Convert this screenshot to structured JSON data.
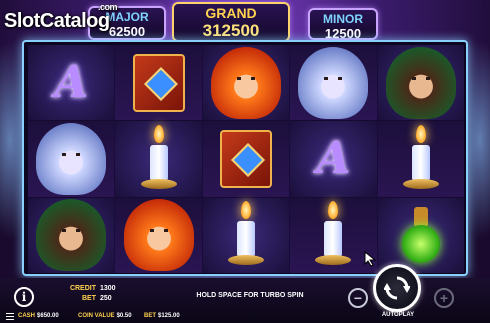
{
  "watermark": {
    "text": "SlotCatalog",
    "suffix": ".com"
  },
  "jackpots": {
    "major": {
      "label": "MAJOR",
      "value": "62500"
    },
    "grand": {
      "label": "GRAND",
      "value": "312500"
    },
    "minor": {
      "label": "MINOR",
      "value": "12500"
    }
  },
  "reels": [
    [
      "letter-a-symbol",
      "ice-witch-symbol",
      "earth-witch-symbol"
    ],
    [
      "spell-book-symbol",
      "candle-symbol",
      "fire-witch-symbol"
    ],
    [
      "fire-witch-symbol",
      "spell-book-symbol",
      "candle-symbol"
    ],
    [
      "ice-witch-symbol",
      "letter-a-symbol",
      "candle-symbol"
    ],
    [
      "earth-witch-symbol",
      "candle-symbol",
      "potion-symbol"
    ]
  ],
  "letter_symbol": "A",
  "info_button": "i",
  "credit": {
    "label": "CREDIT",
    "value": "1300"
  },
  "bet": {
    "label": "BET",
    "value": "250"
  },
  "hold_text": "HOLD SPACE FOR TURBO SPIN",
  "minus_button": "−",
  "plus_button": "+",
  "autoplay_label": "AUTOPLAY",
  "status": {
    "cash": {
      "label": "CASH",
      "value": "$650.00"
    },
    "coin_value": {
      "label": "COIN VALUE",
      "value": "$0.50"
    },
    "bet": {
      "label": "BET",
      "value": "$125.00"
    }
  },
  "colors": {
    "grand": "#ffd34d",
    "minor": "#7fd4ff",
    "frame": "#8ad0ff"
  }
}
